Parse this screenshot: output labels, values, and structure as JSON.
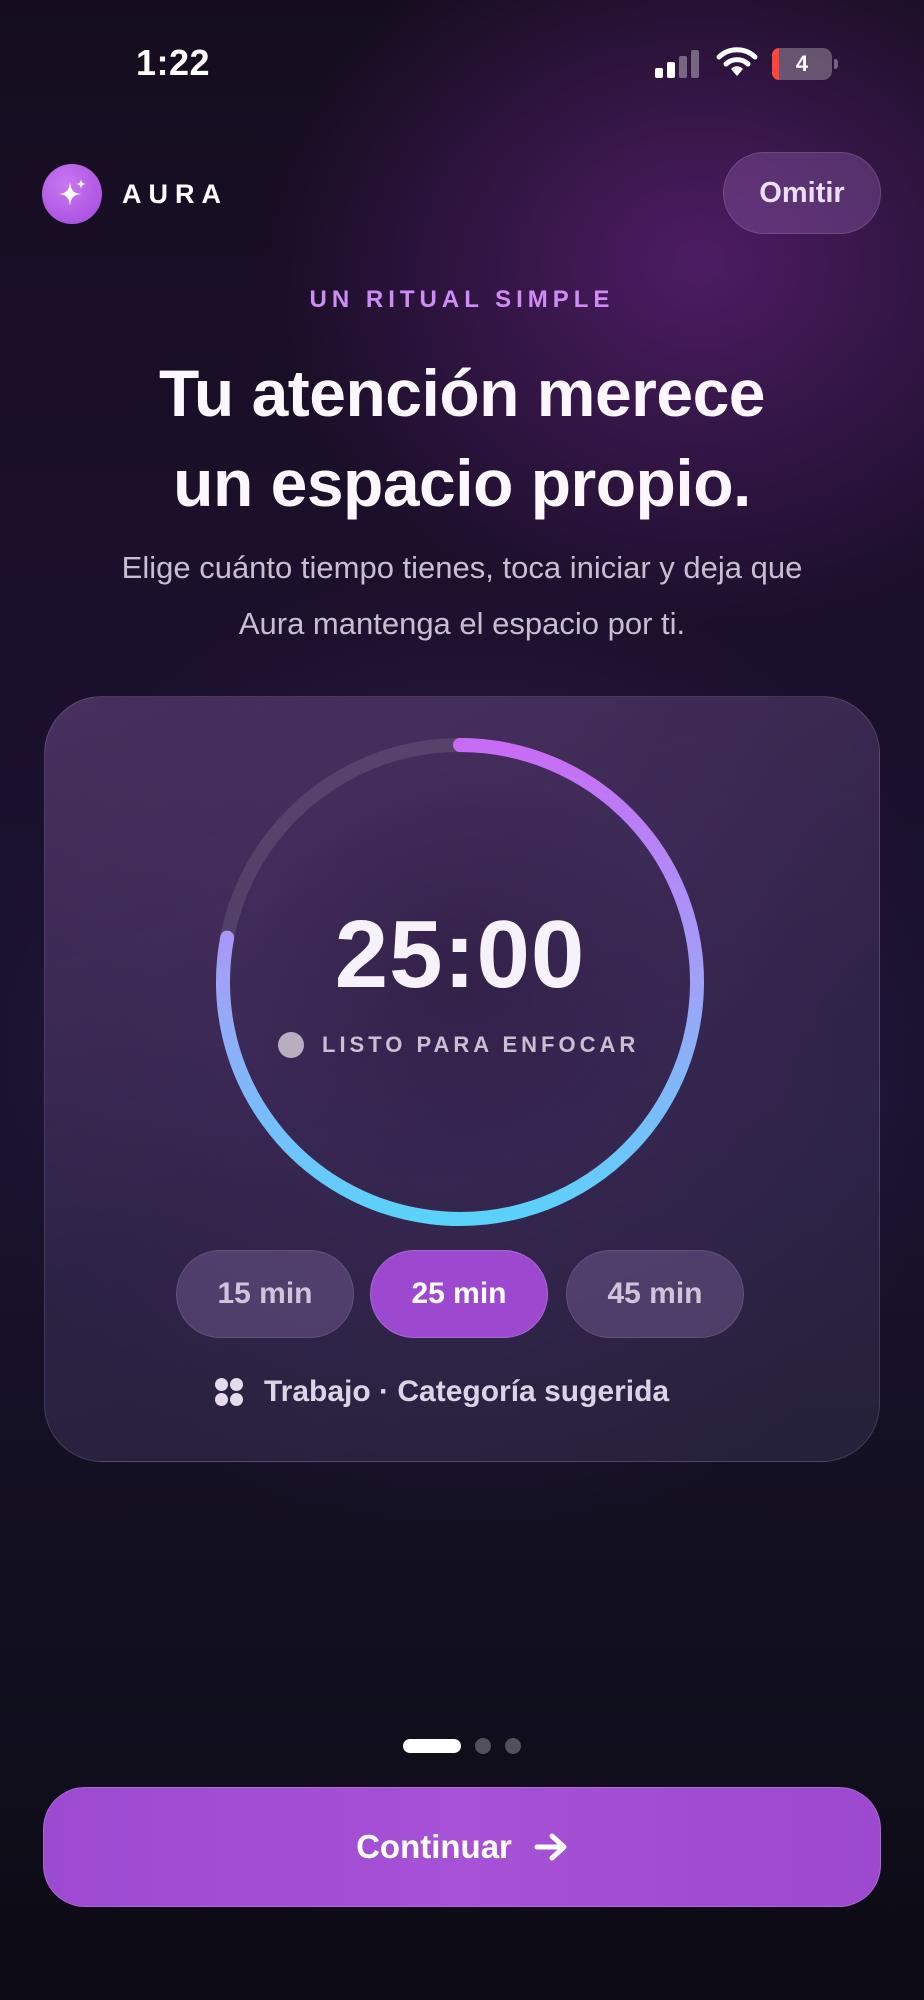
{
  "status_bar": {
    "time": "1:22",
    "battery_level": "4",
    "icons": [
      "cellular-signal-icon",
      "wifi-icon",
      "battery-icon"
    ]
  },
  "header": {
    "brand_name": "AURA",
    "logo_icon": "sparkles-icon",
    "skip_label": "Omitir"
  },
  "hero": {
    "eyebrow": "UN RITUAL SIMPLE",
    "headline_line1": "Tu atención merece",
    "headline_line2": "un espacio propio.",
    "subtitle_line1": "Elige cuánto tiempo tienes, toca iniciar y deja que",
    "subtitle_line2": "Aura mantenga el espacio por ti."
  },
  "timer": {
    "time_remaining": "25:00",
    "status": "LISTO PARA ENFOCAR",
    "ring_progress": 0.78,
    "ring_colors": [
      "#c86cf5",
      "#9fa2f8",
      "#5ad2fa"
    ]
  },
  "durations": [
    {
      "label": "15 min",
      "selected": false
    },
    {
      "label": "25 min",
      "selected": true
    },
    {
      "label": "45 min",
      "selected": false
    }
  ],
  "category": {
    "icon": "category-grid-icon",
    "label": "Trabajo · Categoría sugerida"
  },
  "pager": {
    "total": 3,
    "current": 1
  },
  "cta": {
    "label": "Continuar",
    "icon": "arrow-right-icon"
  },
  "colors": {
    "accent": "#9c49cf",
    "eyebrow": "#d08cf5",
    "battery_low": "#ff453a"
  }
}
